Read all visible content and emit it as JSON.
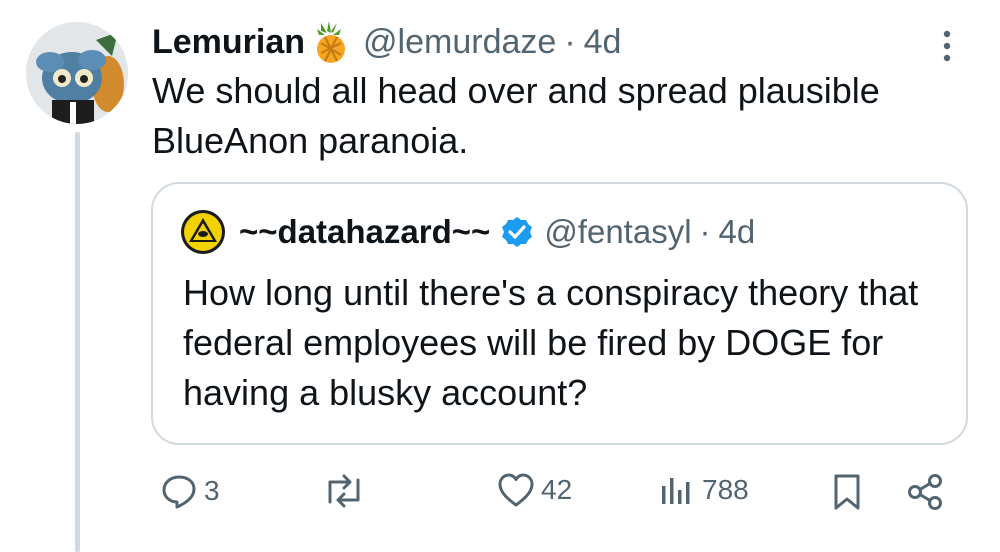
{
  "post": {
    "author_name": "Lemurian",
    "handle": "@lemurdaze",
    "separator": "·",
    "time": "4d",
    "text": "We should all head over and spread plausible BlueAnon paranoia."
  },
  "quote": {
    "author_name": "~~datahazard~~",
    "handle": "@fentasyl",
    "separator": "·",
    "time": "4d",
    "text": "How long until there's a conspiracy theory that federal employees will be fired by DOGE for having a blusky account?",
    "verified": true
  },
  "actions": {
    "replies": "3",
    "likes": "42",
    "views": "788"
  },
  "colors": {
    "text": "#0f1419",
    "muted": "#536471",
    "border": "#cfd9de",
    "verified_blue": "#1d9bf0"
  },
  "icons": [
    "pineapple-emoji-icon",
    "more-options-icon",
    "verified-badge-icon",
    "reply-icon",
    "repost-icon",
    "like-icon",
    "views-icon",
    "bookmark-icon",
    "share-icon"
  ]
}
